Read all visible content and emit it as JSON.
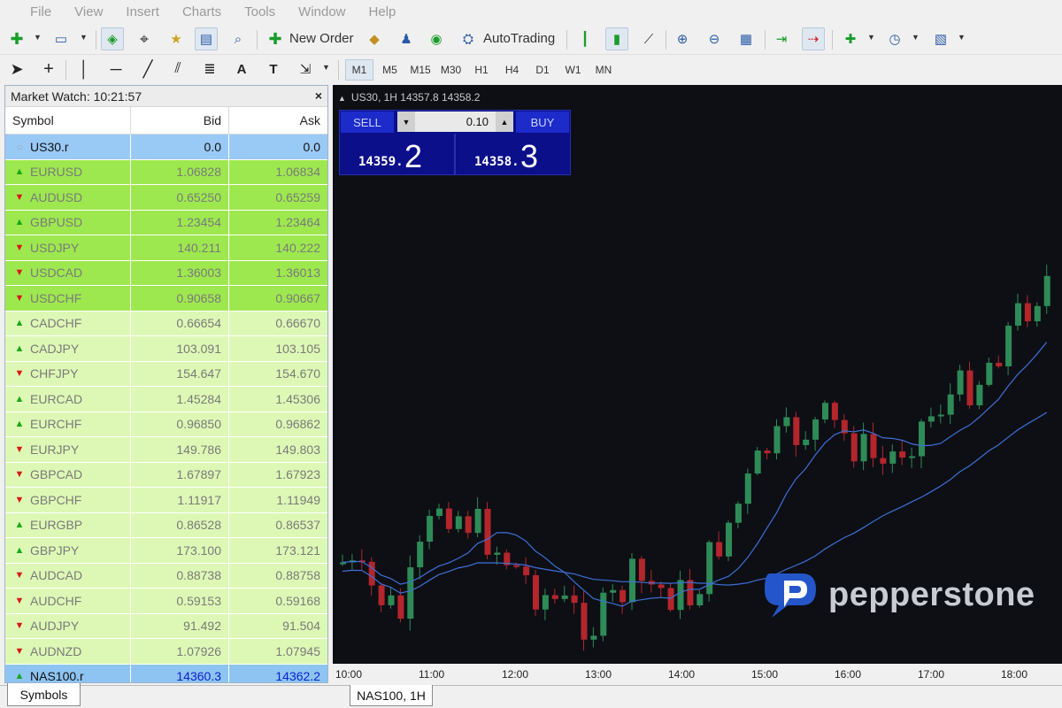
{
  "menu": [
    "File",
    "View",
    "Insert",
    "Charts",
    "Tools",
    "Window",
    "Help"
  ],
  "toolbar": {
    "new_order_label": "New Order",
    "autotrading_label": "AutoTrading",
    "timeframes": [
      "M1",
      "M5",
      "M15",
      "M30",
      "H1",
      "H4",
      "D1",
      "W1",
      "MN"
    ],
    "active_timeframe": "M1"
  },
  "market_watch": {
    "title": "Market Watch: 10:21:57",
    "close_glyph": "×",
    "columns": {
      "symbol": "Symbol",
      "bid": "Bid",
      "ask": "Ask"
    },
    "rows": [
      {
        "symbol": "US30.r",
        "bid": "0.0",
        "ask": "0.0",
        "dir": "dot",
        "style": "sel"
      },
      {
        "symbol": "EURUSD",
        "bid": "1.06828",
        "ask": "1.06834",
        "dir": "up",
        "style": "hot"
      },
      {
        "symbol": "AUDUSD",
        "bid": "0.65250",
        "ask": "0.65259",
        "dir": "down",
        "style": "hot"
      },
      {
        "symbol": "GBPUSD",
        "bid": "1.23454",
        "ask": "1.23464",
        "dir": "up",
        "style": "hot"
      },
      {
        "symbol": "USDJPY",
        "bid": "140.211",
        "ask": "140.222",
        "dir": "down",
        "style": "hot"
      },
      {
        "symbol": "USDCAD",
        "bid": "1.36003",
        "ask": "1.36013",
        "dir": "down",
        "style": "hot"
      },
      {
        "symbol": "USDCHF",
        "bid": "0.90658",
        "ask": "0.90667",
        "dir": "down",
        "style": "hot"
      },
      {
        "symbol": "CADCHF",
        "bid": "0.66654",
        "ask": "0.66670",
        "dir": "up",
        "style": "lt"
      },
      {
        "symbol": "CADJPY",
        "bid": "103.091",
        "ask": "103.105",
        "dir": "up",
        "style": "lt"
      },
      {
        "symbol": "CHFJPY",
        "bid": "154.647",
        "ask": "154.670",
        "dir": "down",
        "style": "lt"
      },
      {
        "symbol": "EURCAD",
        "bid": "1.45284",
        "ask": "1.45306",
        "dir": "up",
        "style": "lt"
      },
      {
        "symbol": "EURCHF",
        "bid": "0.96850",
        "ask": "0.96862",
        "dir": "up",
        "style": "lt"
      },
      {
        "symbol": "EURJPY",
        "bid": "149.786",
        "ask": "149.803",
        "dir": "down",
        "style": "lt"
      },
      {
        "symbol": "GBPCAD",
        "bid": "1.67897",
        "ask": "1.67923",
        "dir": "down",
        "style": "lt"
      },
      {
        "symbol": "GBPCHF",
        "bid": "1.11917",
        "ask": "1.11949",
        "dir": "down",
        "style": "lt"
      },
      {
        "symbol": "EURGBP",
        "bid": "0.86528",
        "ask": "0.86537",
        "dir": "up",
        "style": "lt"
      },
      {
        "symbol": "GBPJPY",
        "bid": "173.100",
        "ask": "173.121",
        "dir": "up",
        "style": "lt"
      },
      {
        "symbol": "AUDCAD",
        "bid": "0.88738",
        "ask": "0.88758",
        "dir": "down",
        "style": "lt"
      },
      {
        "symbol": "AUDCHF",
        "bid": "0.59153",
        "ask": "0.59168",
        "dir": "down",
        "style": "lt"
      },
      {
        "symbol": "AUDJPY",
        "bid": "91.492",
        "ask": "91.504",
        "dir": "down",
        "style": "lt"
      },
      {
        "symbol": "AUDNZD",
        "bid": "1.07926",
        "ask": "1.07945",
        "dir": "down",
        "style": "lt"
      },
      {
        "symbol": "NAS100.r",
        "bid": "14360.3",
        "ask": "14362.2",
        "dir": "up",
        "style": "selblue"
      }
    ],
    "tab_label": "Symbols"
  },
  "chart": {
    "header": "US30, 1H  14357.8  14358.2",
    "one_click": {
      "sell_label": "SELL",
      "buy_label": "BUY",
      "lot": "0.10",
      "sell_price_small": "14359.",
      "sell_price_big": "2",
      "buy_price_small": "14358.",
      "buy_price_big": "3"
    },
    "x_labels": [
      "10:00",
      "11:00",
      "12:00",
      "13:00",
      "14:00",
      "15:00",
      "16:00",
      "17:00",
      "18:00"
    ],
    "tab_label": "NAS100, 1H",
    "logo_text": "pepperstone",
    "colors": {
      "bull": "#2e8b57",
      "bear": "#b3262c",
      "ma": "#3f6fd8",
      "bg": "#0d0f14"
    }
  }
}
